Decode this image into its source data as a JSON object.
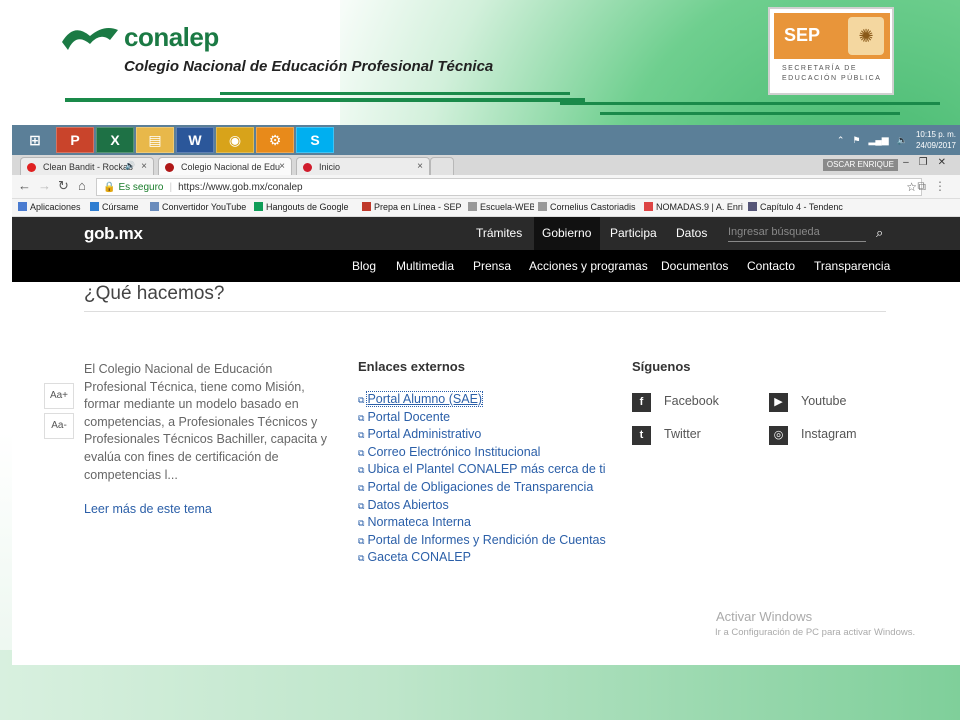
{
  "slide": {
    "logo_word": "conalep",
    "logo_subtitle": "Colegio Nacional de Educación Profesional Técnica",
    "sep_label": "SEP",
    "sep_text1": "SECRETARÍA DE",
    "sep_text2": "EDUCACIÓN PÚBLICA"
  },
  "colors": {
    "conalep_green": "#1b7a44",
    "gob_dark": "#2a2a2a",
    "link_blue": "#2b5fa8",
    "sep_orange": "#e8953a"
  },
  "taskbar": {
    "apps": [
      {
        "name": "windows-start-icon",
        "glyph": "⊞",
        "color": "#5b7f98"
      },
      {
        "name": "powerpoint-icon",
        "glyph": "P",
        "color": "#c9442b"
      },
      {
        "name": "excel-icon",
        "glyph": "X",
        "color": "#1e7145"
      },
      {
        "name": "file-explorer-icon",
        "glyph": "▤",
        "color": "#e8b84a"
      },
      {
        "name": "word-icon",
        "glyph": "W",
        "color": "#2b579a"
      },
      {
        "name": "chrome-icon",
        "glyph": "◉",
        "color": "#d8a31a"
      },
      {
        "name": "settings-gear-icon",
        "glyph": "⚙",
        "color": "#e88a1a"
      },
      {
        "name": "skype-icon",
        "glyph": "S",
        "color": "#00aff0"
      }
    ],
    "time": "10:15 p. m.",
    "date": "24/09/2017"
  },
  "tabs": [
    {
      "title": "Clean Bandit - Rockab",
      "dot": "#e02020",
      "extra": "🔊"
    },
    {
      "title": "Colegio Nacional de Edu",
      "dot": "#b01818",
      "active": true
    },
    {
      "title": "Inicio",
      "dot": "#d01c2c"
    }
  ],
  "profile": "OSCAR ENRIQUE",
  "address": {
    "secure_label": "Es seguro",
    "url": "https://www.gob.mx/conalep"
  },
  "bookmarks": [
    {
      "label": "Aplicaciones",
      "color": "#4a7bd0"
    },
    {
      "label": "Cúrsame",
      "color": "#2e7dd1"
    },
    {
      "label": "Convertidor YouTube",
      "color": "#6a8cbc"
    },
    {
      "label": "Hangouts de Google",
      "color": "#0f9d58"
    },
    {
      "label": "Prepa en Línea - SEP",
      "color": "#c0392b"
    },
    {
      "label": "Escuela-WEB",
      "color": "#999999"
    },
    {
      "label": "Cornelius Castoriadis",
      "color": "#999999"
    },
    {
      "label": "NOMADAS.9 | A. Enri",
      "color": "#d44"
    },
    {
      "label": "Capítulo 4 - Tendenc",
      "color": "#557"
    }
  ],
  "gob": {
    "logo": "gob.mx",
    "nav1": [
      "Trámites",
      "Gobierno",
      "Participa",
      "Datos"
    ],
    "search_placeholder": "Ingresar búsqueda",
    "nav2": [
      "Blog",
      "Multimedia",
      "Prensa",
      "Acciones y programas",
      "Documentos",
      "Contacto",
      "Transparencia"
    ]
  },
  "content": {
    "heading": "¿Qué hacemos?",
    "font_plus": "Aa+",
    "font_minus": "Aa-",
    "mision": "El Colegio Nacional de Educación Profesional Técnica, tiene como Misión, formar mediante un modelo basado en competencias, a Profesionales Técnicos y Profesionales Técnicos Bachiller, capacita y evalúa con fines de certificación de competencias l...",
    "leer_mas": "Leer más de este tema",
    "enlaces_title": "Enlaces externos",
    "enlaces": [
      "Portal Alumno (SAE)",
      "Portal Docente",
      "Portal Administrativo",
      "Correo Electrónico Institucional",
      "Ubica el Plantel CONALEP más cerca de ti",
      "Portal de Obligaciones de Transparencia",
      "Datos Abiertos",
      "Normateca Interna",
      "Portal de Informes y Rendición de Cuentas",
      "Gaceta CONALEP"
    ],
    "siguenos_title": "Síguenos",
    "social": [
      {
        "label": "Facebook",
        "icon": "facebook-icon",
        "glyph": "f"
      },
      {
        "label": "Youtube",
        "icon": "youtube-icon",
        "glyph": "▶"
      },
      {
        "label": "Twitter",
        "icon": "twitter-icon",
        "glyph": "t"
      },
      {
        "label": "Instagram",
        "icon": "instagram-icon",
        "glyph": "◎"
      }
    ]
  },
  "watermark": {
    "title": "Activar Windows",
    "sub": "Ir a Configuración de PC para activar Windows."
  }
}
